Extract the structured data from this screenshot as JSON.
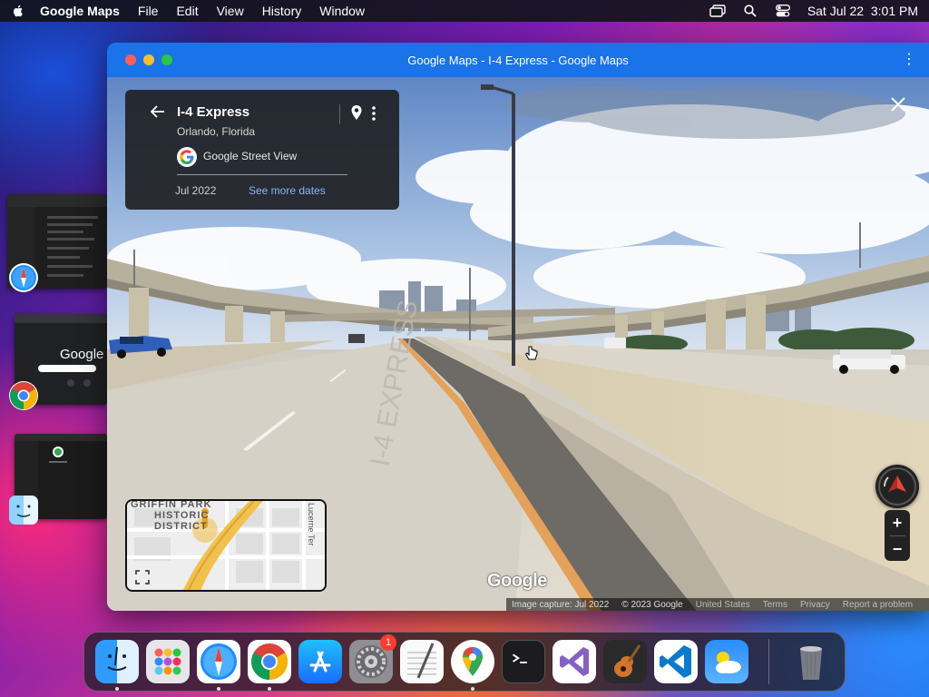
{
  "menubar": {
    "app_name": "Google Maps",
    "items": [
      "File",
      "Edit",
      "View",
      "History",
      "Window"
    ],
    "date_time": "Sat Jul 22  3:01 PM"
  },
  "window": {
    "title": "Google Maps - I-4 Express - Google Maps"
  },
  "info_card": {
    "title": "I-4 Express",
    "subtitle": "Orlando, Florida",
    "source": "Google Street View",
    "date": "Jul 2022",
    "see_more": "See more dates"
  },
  "minimap": {
    "label_line1": "GRIFFIN PARK",
    "label_line2": "HISTORIC",
    "label_line3": "DISTRICT",
    "street": "Lucerne Ter"
  },
  "watermark": "Google",
  "footer": {
    "capture": "Image capture: Jul 2022",
    "copyright": "© 2023 Google",
    "country": "United States",
    "terms": "Terms",
    "privacy": "Privacy",
    "report": "Report a problem"
  },
  "thumbnails": {
    "google_text": "Google"
  },
  "dock": {
    "items": [
      "Finder",
      "Launchpad",
      "Safari",
      "Chrome",
      "App Store",
      "System Settings",
      "TextEdit",
      "Google Maps",
      "Terminal",
      "Visual Studio",
      "GarageBand",
      "VS Code",
      "Weather",
      "Trash"
    ],
    "settings_badge": "1"
  },
  "colors": {
    "titlebar": "#1a73e8",
    "link": "#8ab4f8"
  }
}
